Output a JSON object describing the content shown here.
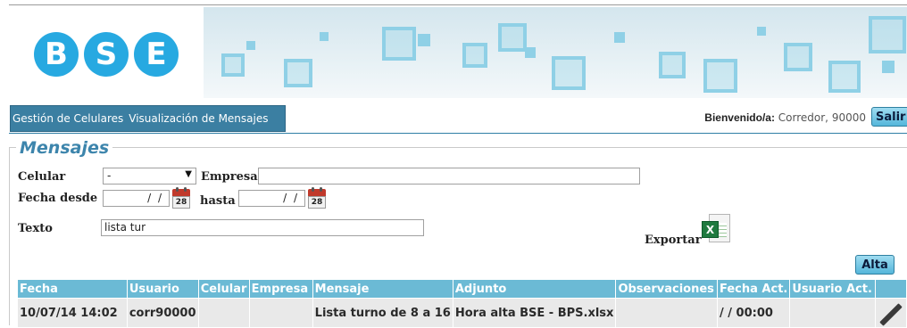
{
  "header": {
    "logo_letters": [
      "B",
      "S",
      "E"
    ],
    "brand_color": "#27a9e1"
  },
  "menu": {
    "items": [
      "Gestión de Celulares",
      "Visualización de Mensajes"
    ]
  },
  "user": {
    "welcome_label": "Bienvenido/a:",
    "welcome_value": "Corredor, 90000",
    "logout_label": "Salir"
  },
  "form": {
    "legend": "Mensajes",
    "celular_label": "Celular",
    "celular_value": "-",
    "empresa_label": "Empresa",
    "empresa_value": "",
    "fecha_desde_label": "Fecha desde",
    "fecha_desde_value": "/ /",
    "hasta_label": "hasta",
    "hasta_value": "/ /",
    "calendar_day": "28",
    "texto_label": "Texto",
    "texto_value": "lista tur",
    "export_label": "Exportar",
    "add_label": "Alta"
  },
  "table": {
    "headers": [
      "Fecha",
      "Usuario",
      "Celular",
      "Empresa",
      "Mensaje",
      "Adjunto",
      "Observaciones",
      "Fecha Act.",
      "Usuario Act.",
      ""
    ],
    "rows": [
      {
        "fecha": "10/07/14 14:02",
        "usuario": "corr90000",
        "celular": "",
        "empresa": "",
        "mensaje": "Lista turno de 8 a 16",
        "adjunto": "Hora alta BSE - BPS.xlsx",
        "observaciones": "",
        "fecha_act": "/ / 00:00",
        "usuario_act": ""
      }
    ]
  },
  "icons": [
    "excel-export-icon",
    "calendar-icon",
    "pencil-edit-icon"
  ]
}
